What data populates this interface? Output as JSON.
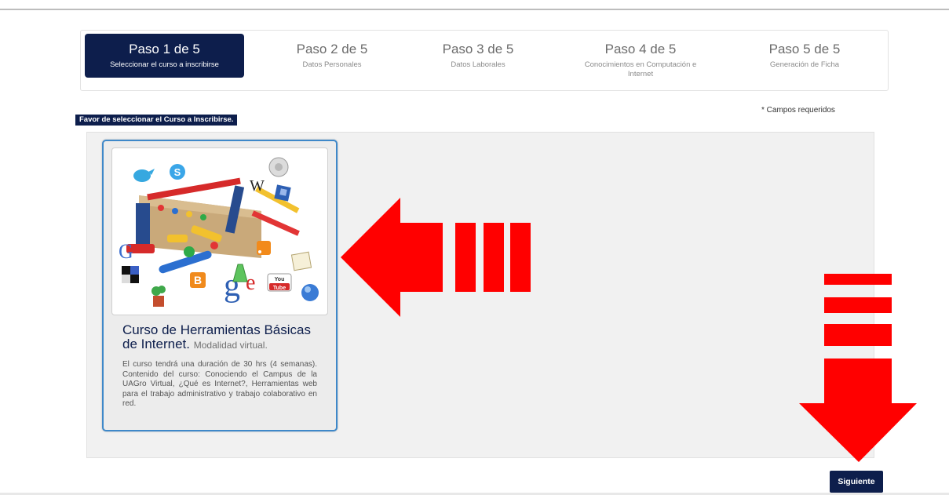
{
  "steps": [
    {
      "title": "Paso 1 de 5",
      "subtitle": "Seleccionar el curso a inscribirse",
      "active": true
    },
    {
      "title": "Paso 2 de 5",
      "subtitle": "Datos Personales",
      "active": false
    },
    {
      "title": "Paso 3 de 5",
      "subtitle": "Datos Laborales",
      "active": false
    },
    {
      "title": "Paso 4 de 5",
      "subtitle": "Conocimientos en Computación e Internet",
      "active": false
    },
    {
      "title": "Paso 5 de 5",
      "subtitle": "Generación de Ficha",
      "active": false
    }
  ],
  "form": {
    "instruction": "Favor de seleccionar el Curso a Inscribirse.",
    "required_note": "* Campos requeridos"
  },
  "course": {
    "title": "Curso de Herramientas Básicas de Internet.",
    "modality": "Modalidad virtual.",
    "description": "El curso tendrá una duración de 30 hrs (4 semanas). Contenido del curso: Conociendo el Campus de la UAGro Virtual, ¿Qué es Internet?, Herramientas web para el trabajo administrativo y trabajo colaborativo en red.",
    "image_letters": {
      "wiki": "W",
      "google": "G",
      "google_large": "g",
      "google_e": "e",
      "youtube_top": "You",
      "youtube_bottom": "Tube",
      "skype": "S",
      "blogger": "B"
    }
  },
  "buttons": {
    "next": "Siguiente"
  },
  "colors": {
    "navy": "#0d1e4c",
    "card_border": "#3e88c9",
    "arrow_red": "#ff0000"
  },
  "icons": [
    "twitter-icon",
    "skype-icon",
    "wikipedia-icon",
    "w-icon",
    "delicious-icon",
    "google-icon",
    "rss-icon",
    "blogger-icon",
    "youtube-icon",
    "chrome-globe-icon",
    "note-icon",
    "toolbox-icon"
  ]
}
